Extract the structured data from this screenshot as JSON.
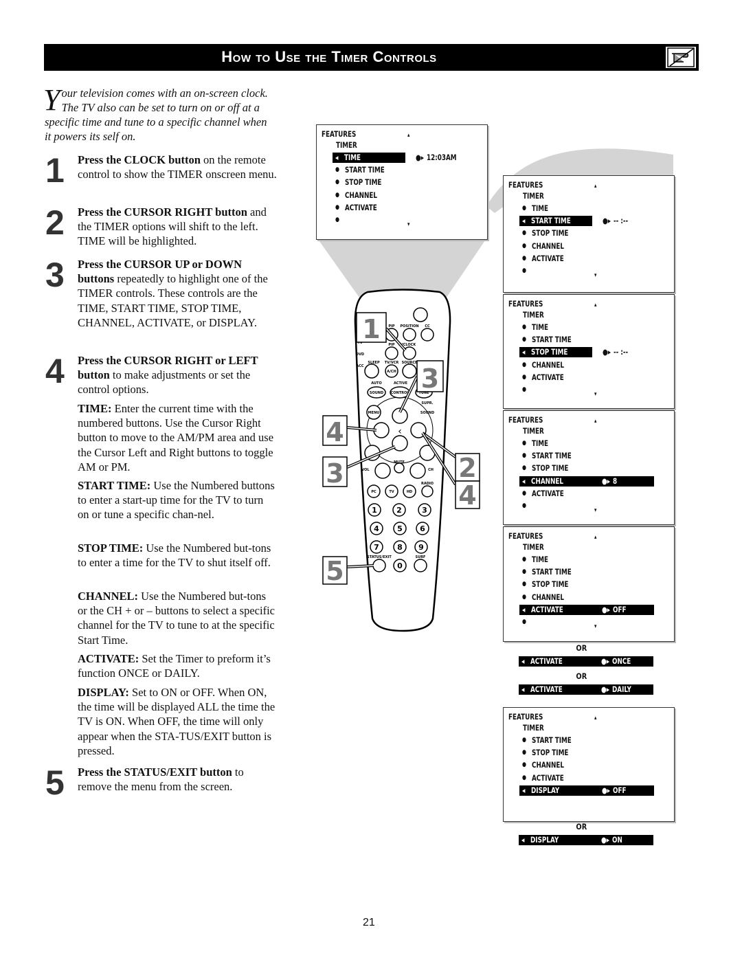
{
  "header": {
    "title": "How to Use the Timer Controls",
    "icon": "pointing-hand-icon"
  },
  "intro": {
    "dropcap": "Y",
    "text": "our television comes with an on-screen clock. The TV also can be set to turn on or off at a specific time and tune to a specific channel when it powers its self on."
  },
  "steps": [
    {
      "num": "1",
      "bold": "Press the CLOCK button",
      "text": " on the remote control to show the TIMER onscreen menu."
    },
    {
      "num": "2",
      "bold": "Press the CURSOR RIGHT button",
      "text": " and the TIMER options will shift to the left. TIME will be highlighted."
    },
    {
      "num": "3",
      "bold": "Press the CURSOR UP or DOWN buttons",
      "text": " repeatedly to highlight one of the TIMER controls. These controls are the TIME, START TIME, STOP TIME, CHANNEL, ACTIVATE, or DISPLAY."
    },
    {
      "num": "4",
      "bold": "Press the CURSOR RIGHT or LEFT button",
      "text": " to make adjustments or set the control options."
    }
  ],
  "options": [
    {
      "bold": "TIME:",
      "text": " Enter the current time with the numbered buttons. Use the Cursor Right button to move to the AM/PM area and use the Cursor Left and Right buttons to toggle AM or PM."
    },
    {
      "bold": "START TIME:",
      "text": " Use the Numbered buttons to enter a start-up time for the TV to turn on or tune a specific chan-nel."
    },
    {
      "bold": "STOP TIME:",
      "text": " Use the Numbered but-tons to enter a time for the TV to shut itself off."
    },
    {
      "bold": "CHANNEL:",
      "text": " Use the Numbered but-tons or the CH + or – buttons to select a specific channel for the TV to tune to at the specific Start Time."
    },
    {
      "bold": "ACTIVATE:",
      "text": " Set the Timer to preform it’s function ONCE or DAILY."
    },
    {
      "bold": "DISPLAY:",
      "text": " Set to ON or OFF. When ON, the time will be displayed ALL the time the TV is ON. When OFF, the time will only appear when the STA-TUS/EXIT button is pressed."
    }
  ],
  "step5": {
    "num": "5",
    "bold": "Press the STATUS/EXIT button",
    "text": " to remove the menu from the screen."
  },
  "menus": [
    {
      "title": "FEATURES",
      "sub": "TIMER",
      "items": [
        "TIME",
        "START TIME",
        "STOP TIME",
        "CHANNEL",
        "ACTIVATE",
        ""
      ],
      "selected": 0,
      "value": "12:03AM",
      "full_bar": false
    },
    {
      "title": "FEATURES",
      "sub": "TIMER",
      "items": [
        "TIME",
        "START TIME",
        "STOP TIME",
        "CHANNEL",
        "ACTIVATE",
        ""
      ],
      "selected": 1,
      "value": "-- :--",
      "full_bar": false
    },
    {
      "title": "FEATURES",
      "sub": "TIMER",
      "items": [
        "TIME",
        "START TIME",
        "STOP TIME",
        "CHANNEL",
        "ACTIVATE",
        ""
      ],
      "selected": 2,
      "value": "-- :--",
      "full_bar": false
    },
    {
      "title": "FEATURES",
      "sub": "TIMER",
      "items": [
        "TIME",
        "START TIME",
        "STOP TIME",
        "CHANNEL",
        "ACTIVATE",
        ""
      ],
      "selected": 3,
      "value": "8",
      "full_bar": true
    },
    {
      "title": "FEATURES",
      "sub": "TIMER",
      "items": [
        "TIME",
        "START TIME",
        "STOP TIME",
        "CHANNEL",
        "ACTIVATE",
        ""
      ],
      "selected": 4,
      "value": "OFF",
      "full_bar": true
    },
    {
      "title": "FEATURES",
      "sub": "TIMER",
      "items": [
        "START TIME",
        "STOP TIME",
        "CHANNEL",
        "ACTIVATE",
        "DISPLAY"
      ],
      "selected": 4,
      "value": "OFF",
      "full_bar": true
    }
  ],
  "alternates": [
    {
      "or": "OR",
      "label": "ACTIVATE",
      "value": "ONCE"
    },
    {
      "or": "OR",
      "label": "ACTIVATE",
      "value": "DAILY"
    },
    {
      "or": "OR",
      "label": "DISPLAY",
      "value": "ON"
    }
  ],
  "remote": {
    "labels": [
      "PIP",
      "POSITION",
      "CC",
      "PIP",
      "TV",
      "CLOCK",
      "SLEEP",
      "TV/VCR",
      "SOURCE",
      "AUTO",
      "ACTIVE",
      "SUPR.",
      "MUTE",
      "VOL",
      "CH",
      "RADIO",
      "STATUS/EXIT",
      "SURF",
      "TV",
      "DVD",
      "ACC"
    ],
    "buttons": [
      "SOUND",
      "CONTROL",
      "TUNE",
      "MENU",
      "SOUND",
      "A/CH",
      "PC",
      "TV",
      "HD",
      "1",
      "2",
      "3",
      "4",
      "5",
      "6",
      "7",
      "8",
      "9",
      "0"
    ],
    "callouts": [
      "1",
      "3",
      "4",
      "3",
      "2",
      "4",
      "5"
    ]
  },
  "page_number": "21"
}
